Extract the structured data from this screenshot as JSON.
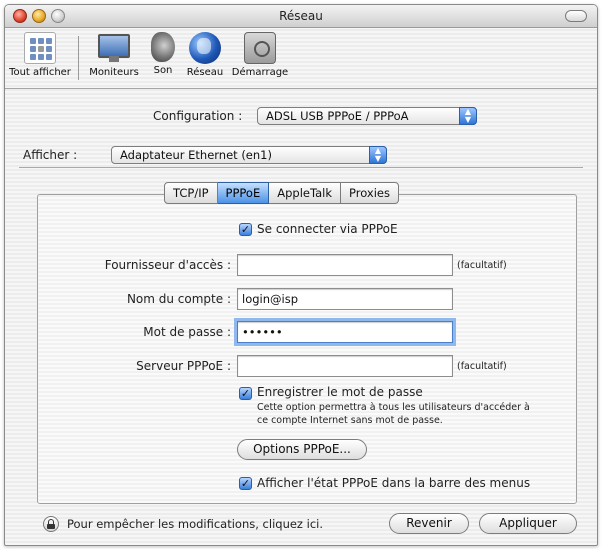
{
  "window": {
    "title": "Réseau"
  },
  "toolbar": {
    "items": [
      {
        "label": "Tout afficher",
        "icon": "show-all-icon"
      },
      {
        "label": "Moniteurs",
        "icon": "monitor-icon"
      },
      {
        "label": "Son",
        "icon": "speaker-icon"
      },
      {
        "label": "Réseau",
        "icon": "globe-icon"
      },
      {
        "label": "Démarrage",
        "icon": "startup-disk-icon"
      }
    ]
  },
  "configuration": {
    "label": "Configuration :",
    "value": "ADSL USB PPPoE / PPPoA"
  },
  "afficher": {
    "label": "Afficher :",
    "value": "Adaptateur Ethernet (en1)"
  },
  "tabs": [
    {
      "label": "TCP/IP",
      "active": false
    },
    {
      "label": "PPPoE",
      "active": true
    },
    {
      "label": "AppleTalk",
      "active": false
    },
    {
      "label": "Proxies",
      "active": false
    }
  ],
  "pppoe": {
    "connect_via": {
      "label": "Se connecter via PPPoE",
      "checked": true
    },
    "provider": {
      "label": "Fournisseur d'accès :",
      "value": "",
      "hint": "(facultatif)"
    },
    "account": {
      "label": "Nom du compte :",
      "value": "login@isp"
    },
    "password": {
      "label": "Mot de passe :",
      "value": "••••••"
    },
    "server": {
      "label": "Serveur PPPoE :",
      "value": "",
      "hint": "(facultatif)"
    },
    "save_password": {
      "label": "Enregistrer le mot de passe",
      "checked": true,
      "description_line1": "Cette option permettra à tous les utilisateurs d'accéder à",
      "description_line2": "ce compte Internet sans mot de passe."
    },
    "options_button": "Options PPPoE...",
    "show_status": {
      "label": "Afficher l'état PPPoE dans la barre des menus",
      "checked": true
    }
  },
  "footer": {
    "lock_text": "Pour empêcher les modifications, cliquez ici.",
    "revert_button": "Revenir",
    "apply_button": "Appliquer"
  },
  "colors": {
    "accent": "#3a7fdc",
    "focus_ring": "#8fb8ef"
  }
}
